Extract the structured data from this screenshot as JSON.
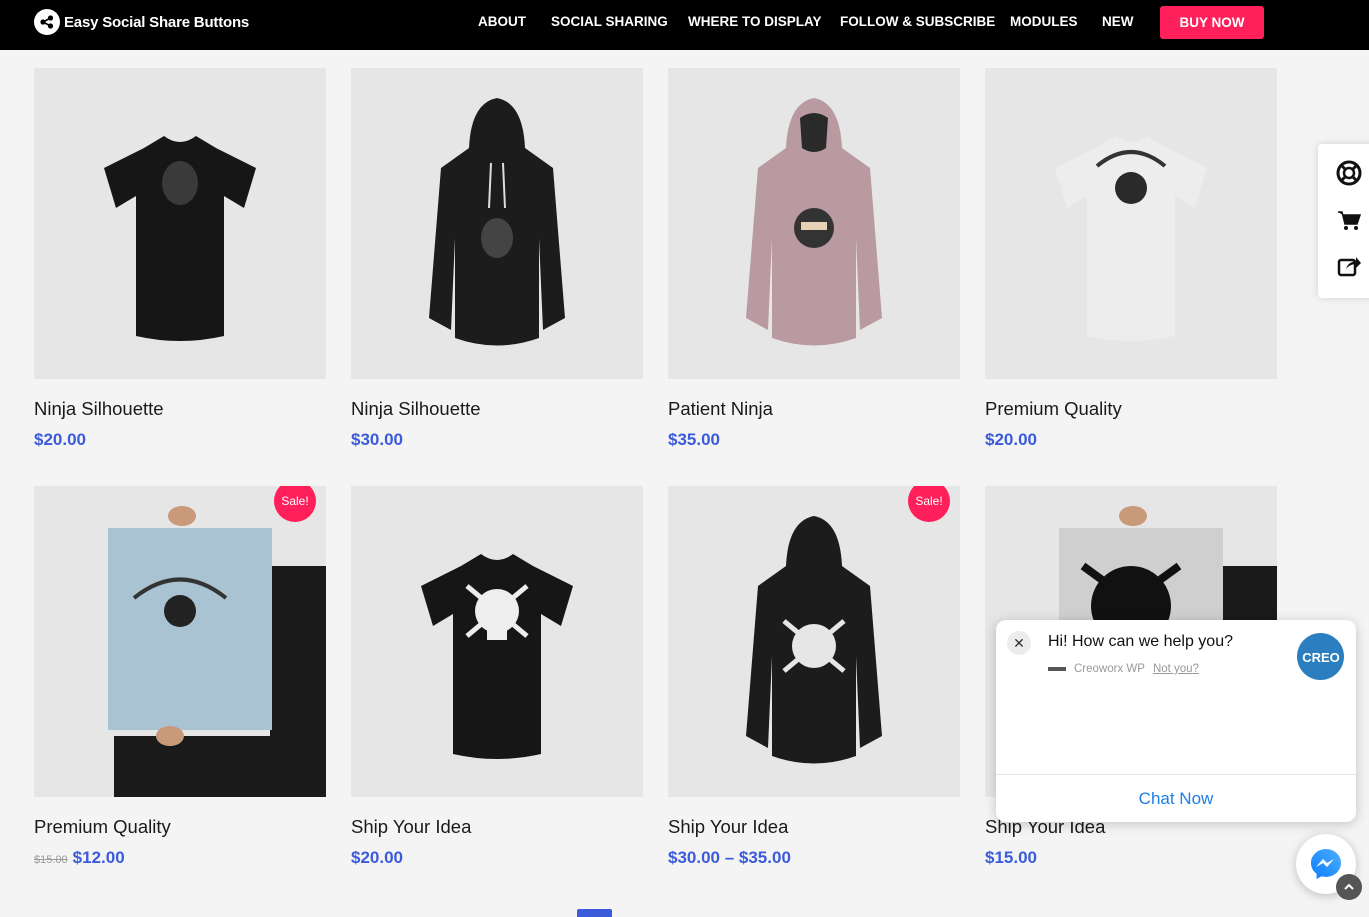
{
  "header": {
    "brand": "Easy Social Share Buttons",
    "nav": [
      "ABOUT",
      "SOCIAL SHARING",
      "WHERE TO DISPLAY",
      "FOLLOW & SUBSCRIBE",
      "MODULES",
      "NEW"
    ],
    "cta": "BUY NOW"
  },
  "products": [
    {
      "title": "Ninja Silhouette",
      "price": "$20.00"
    },
    {
      "title": "Ninja Silhouette",
      "price": "$30.00"
    },
    {
      "title": "Patient Ninja",
      "price": "$35.00"
    },
    {
      "title": "Premium Quality",
      "price": "$20.00"
    },
    {
      "title": "Premium Quality",
      "old_price": "$15.00",
      "price": "$12.00",
      "badge": "Sale!"
    },
    {
      "title": "Ship Your Idea",
      "price": "$20.00"
    },
    {
      "title": "Ship Your Idea",
      "price": "$30.00 – $35.00",
      "badge": "Sale!"
    },
    {
      "title": "Ship Your Idea",
      "price": "$15.00"
    }
  ],
  "side_panel": {
    "icons": [
      "lifebuoy-icon",
      "cart-icon",
      "share-icon"
    ]
  },
  "chat": {
    "greeting": "Hi! How can we help you?",
    "agent": "Creoworx WP",
    "not_you": "Not you?",
    "avatar_text": "CREO",
    "cta": "Chat Now"
  },
  "colors": {
    "accent": "#ff1f5a",
    "price": "#3b5bdb",
    "chat_link": "#1d7ee8"
  }
}
